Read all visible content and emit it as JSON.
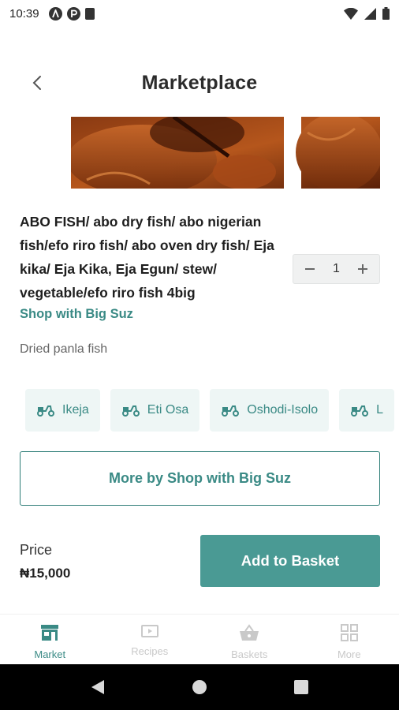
{
  "status_bar": {
    "time": "10:39",
    "left_icons": [
      "notification-a-icon",
      "notification-p-icon",
      "sd-card-icon"
    ],
    "right_icons": [
      "wifi-icon",
      "signal-icon",
      "battery-icon"
    ]
  },
  "header": {
    "title": "Marketplace",
    "back_icon": "chevron-left-icon"
  },
  "product": {
    "title": "ABO FISH/ abo dry fish/ abo nigerian fish/efo riro fish/ abo oven dry fish/ Eja kika/ Eja Kika, Eja Egun/ stew/ vegetable/efo riro fish 4big",
    "shop": "Shop with Big Suz",
    "description": "Dried panla fish",
    "quantity": "1"
  },
  "locations": [
    {
      "label": "Ikeja",
      "icon": "scooter-icon"
    },
    {
      "label": "Eti Osa",
      "icon": "scooter-icon"
    },
    {
      "label": "Oshodi-Isolo",
      "icon": "scooter-icon"
    },
    {
      "label": "L",
      "icon": "scooter-icon"
    }
  ],
  "more_by": {
    "label": "More by Shop with Big Suz"
  },
  "purchase": {
    "price_label": "Price",
    "price_value": "₦15,000",
    "add_button": "Add to Basket"
  },
  "bottom_nav": {
    "items": [
      {
        "label": "Market",
        "icon": "store-icon",
        "active": true
      },
      {
        "label": "Recipes",
        "icon": "video-icon",
        "active": false
      },
      {
        "label": "Baskets",
        "icon": "basket-icon",
        "active": false
      },
      {
        "label": "More",
        "icon": "grid-icon",
        "active": false
      }
    ]
  },
  "colors": {
    "accent": "#3a8a85",
    "button_bg": "#4a9a94",
    "chip_bg": "#eef6f5"
  }
}
